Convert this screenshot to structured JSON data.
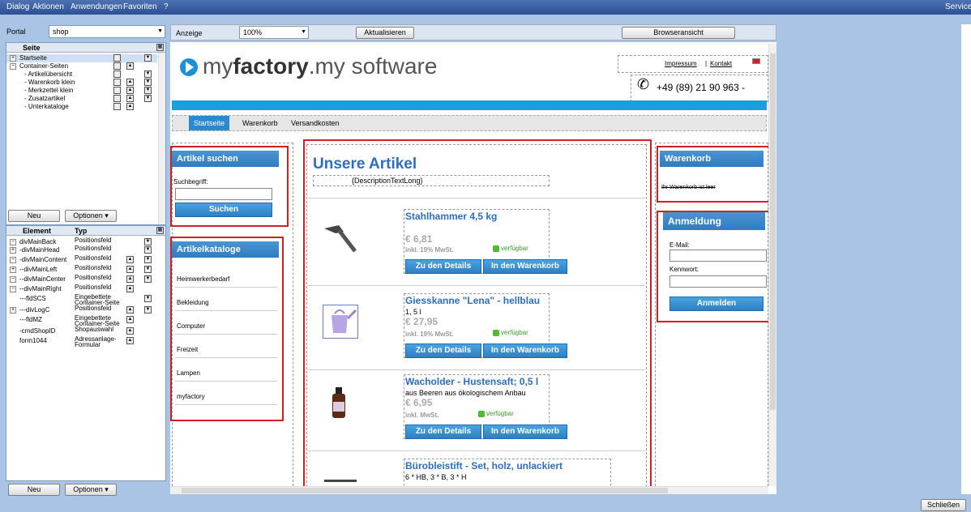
{
  "menu": {
    "items": [
      "Dialog",
      "Aktionen",
      "Anwendungen",
      "Favoriten",
      "?"
    ],
    "service": "Service"
  },
  "left": {
    "portal_label": "Portal",
    "portal_value": "shop",
    "page_tree": {
      "header": "Seite",
      "rows": [
        "Startseite",
        "Container-Seiten",
        "- Artikelübersicht",
        "- Warenkorb klein",
        "- Merkzettel klein",
        "- Zusatzartikel",
        "- Unterkataloge"
      ]
    },
    "new_label": "Neu",
    "options_label": "Optionen",
    "element_table": {
      "headers": [
        "Element",
        "Typ"
      ],
      "rows": [
        [
          "divMainBack",
          "Positionsfeld"
        ],
        [
          "-divMainHead",
          "Positionsfeld"
        ],
        [
          "-divMainContent",
          "Positionsfeld"
        ],
        [
          "--divMainLeft",
          "Positionsfeld"
        ],
        [
          "--divMainCenter",
          "Positionsfeld"
        ],
        [
          "--divMainRight",
          "Positionsfeld"
        ],
        [
          "---fldSCS",
          "Eingebettete Container-Seite"
        ],
        [
          "---divLogC",
          "Positionsfeld"
        ],
        [
          "---fldMZ",
          "Eingebettete Container-Seite"
        ],
        [
          "-cmdShopID",
          "Shopauswahl"
        ],
        [
          "form1044",
          "Adressanlage-Formular"
        ]
      ]
    },
    "new2_label": "Neu",
    "options2_label": "Optionen"
  },
  "toolbar": {
    "anzeige_label": "Anzeige",
    "zoom": "100%",
    "refresh": "Aktualisieren",
    "browser_view": "Browseransicht"
  },
  "shop": {
    "logo_pre": "my",
    "logo_bold": "factory",
    "logo_post": ".my software",
    "impressum": "Impressum",
    "kontakt": "Kontakt",
    "phone": "+49 (89) 21 90 963 -",
    "nav": [
      "Startseite",
      "Warenkorb",
      "Versandkosten"
    ],
    "search": {
      "title": "Artikel suchen",
      "label": "Suchbegriff:",
      "button": "Suchen"
    },
    "catalogs": {
      "title": "Artikelkataloge",
      "items": [
        "Heimwerkerbedarf",
        "Bekleidung",
        "Computer",
        "Freizeit",
        "Lampen",
        "myfactory"
      ]
    },
    "articles": {
      "title": "Unsere Artikel",
      "desc": "{DescriptionTextLong}",
      "products": [
        {
          "name": "Stahlhammer 4,5 kg",
          "sub": "",
          "price": "€ 6,81",
          "vat": "inkl. 19% MwSt.",
          "avail": "verfügbar"
        },
        {
          "name": "Giesskanne \"Lena\" - hellblau",
          "sub": "1, 5 l",
          "price": "€ 27,95",
          "vat": "inkl. 19% MwSt.",
          "avail": "verfügbar"
        },
        {
          "name": "Wacholder - Hustensaft; 0,5 l",
          "sub": "aus Beeren aus ökologischem Anbau",
          "price": "€ 6,95",
          "vat": "inkl. MwSt.",
          "avail": "verfügbar"
        },
        {
          "name": "Bürobleistift - Set, holz, unlackiert",
          "sub": "6 * HB, 3 * B, 3 * H",
          "price": "",
          "vat": "",
          "avail": ""
        }
      ],
      "details_btn": "Zu den Details",
      "cart_btn": "In den Warenkorb"
    },
    "cart": {
      "title": "Warenkorb",
      "empty": "Ihr Warenkorb ist leer"
    },
    "login": {
      "title": "Anmeldung",
      "email": "E-Mail:",
      "password": "Kennwort:",
      "button": "Anmelden"
    }
  },
  "close_label": "Schließen"
}
